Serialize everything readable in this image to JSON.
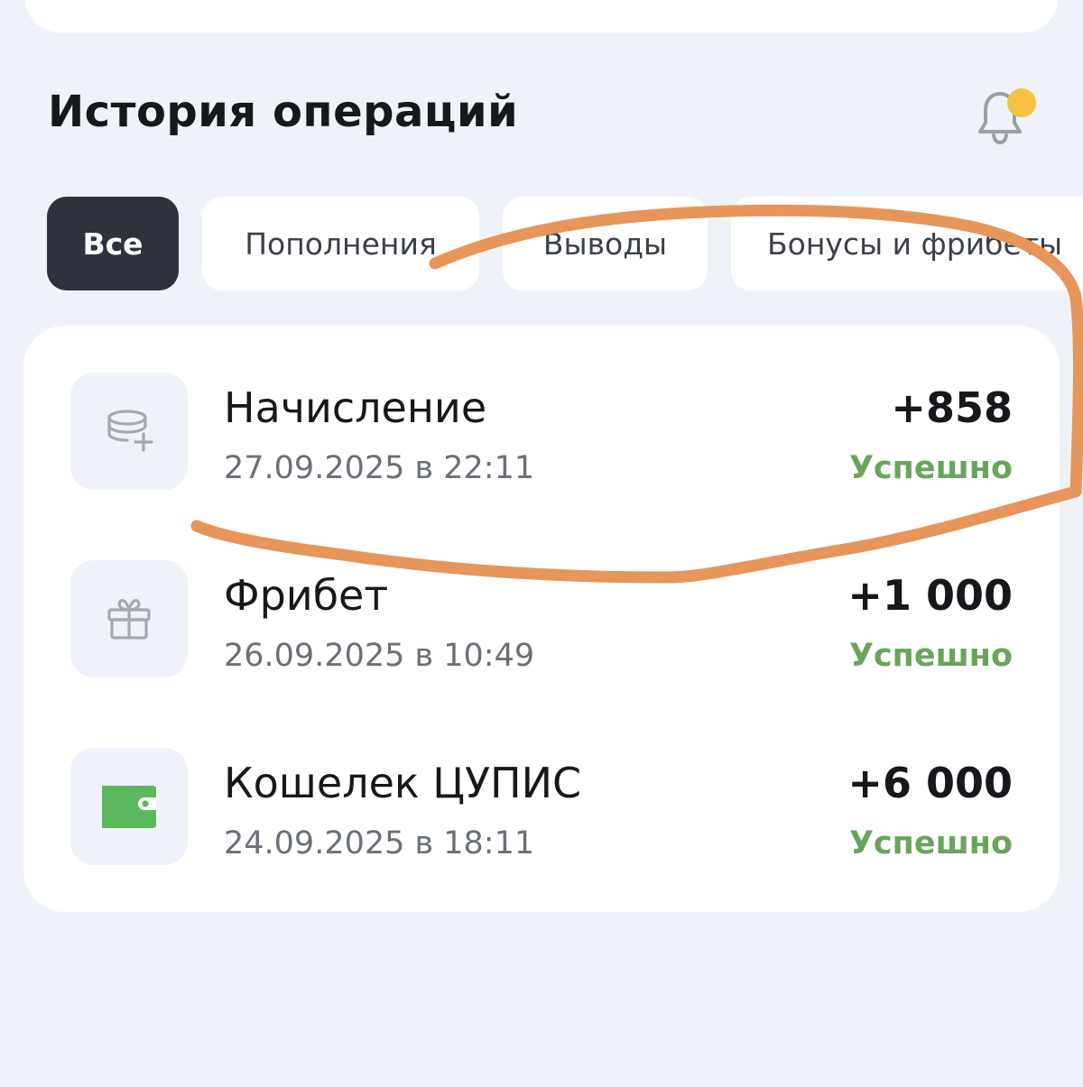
{
  "header": {
    "title": "История операций",
    "bell_icon": "bell-icon",
    "has_unread": true,
    "unread_dot_color": "#f5c242"
  },
  "tabs": [
    {
      "label": "Все",
      "active": true
    },
    {
      "label": "Пополнения",
      "active": false
    },
    {
      "label": "Выводы",
      "active": false
    },
    {
      "label": "Бонусы и фрибеты",
      "active": false
    }
  ],
  "transactions": [
    {
      "title": "Начисление",
      "date": "27.09.2025 в 22:11",
      "amount": "+858",
      "status": "Успешно",
      "icon": "coins-plus-icon"
    },
    {
      "title": "Фрибет",
      "date": "26.09.2025 в 10:49",
      "amount": "+1 000",
      "status": "Успешно",
      "icon": "gift-icon"
    },
    {
      "title": "Кошелек ЦУПИС",
      "date": "24.09.2025 в 18:11",
      "amount": "+6 000",
      "status": "Успешно",
      "icon": "wallet-icon"
    }
  ],
  "colors": {
    "background": "#eff3f9",
    "active_tab": "#2e323d",
    "status_success": "#6aa45c",
    "wallet_green": "#5cb85c",
    "annotation_stroke": "#e8955a"
  }
}
